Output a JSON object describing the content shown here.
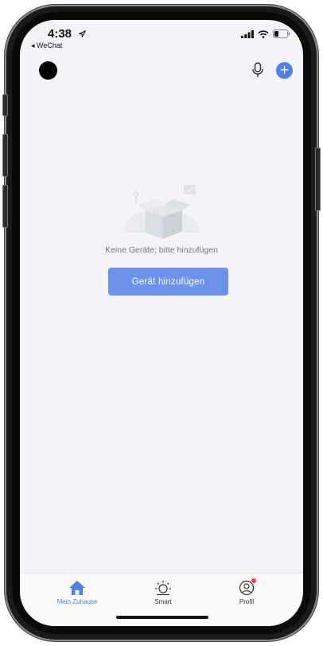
{
  "status_bar": {
    "time": "4:38",
    "back_app": "◂ WeChat"
  },
  "header": {
    "mic_icon": "microphone-icon",
    "add_icon": "plus-icon",
    "add_symbol": "+"
  },
  "empty_state": {
    "message": "Keine Geräte; bitte hinzufügen",
    "button_label": "Gerät hinzufügen"
  },
  "tabs": [
    {
      "label": "Mein Zuhause",
      "icon": "home-icon",
      "active": true
    },
    {
      "label": "Smart",
      "icon": "sun-icon",
      "active": false
    },
    {
      "label": "Profil",
      "icon": "profile-icon",
      "active": false,
      "badge": true
    }
  ],
  "colors": {
    "accent": "#4f7fe8",
    "button": "#6b93ec",
    "background": "#f3f4f8",
    "badge": "#f0443a"
  }
}
